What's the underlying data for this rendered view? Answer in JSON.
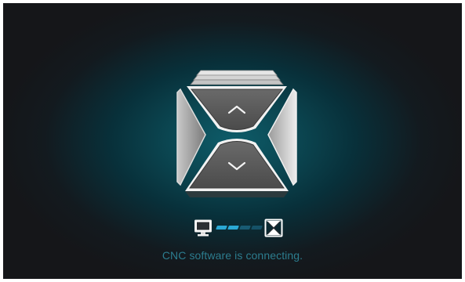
{
  "status": {
    "message": "CNC software is connecting."
  },
  "logo": {
    "up_icon": "chevron-up-icon",
    "down_icon": "chevron-down-icon"
  },
  "connection": {
    "source_icon": "computer-monitor-icon",
    "target_icon": "cnc-machine-icon",
    "segments_total": 4,
    "segments_active": 2
  },
  "colors": {
    "accent": "#2aa8d4",
    "accent_dim": "#1d6c8a",
    "text": "#2c7d8f",
    "panel": "#5b5b5b"
  }
}
